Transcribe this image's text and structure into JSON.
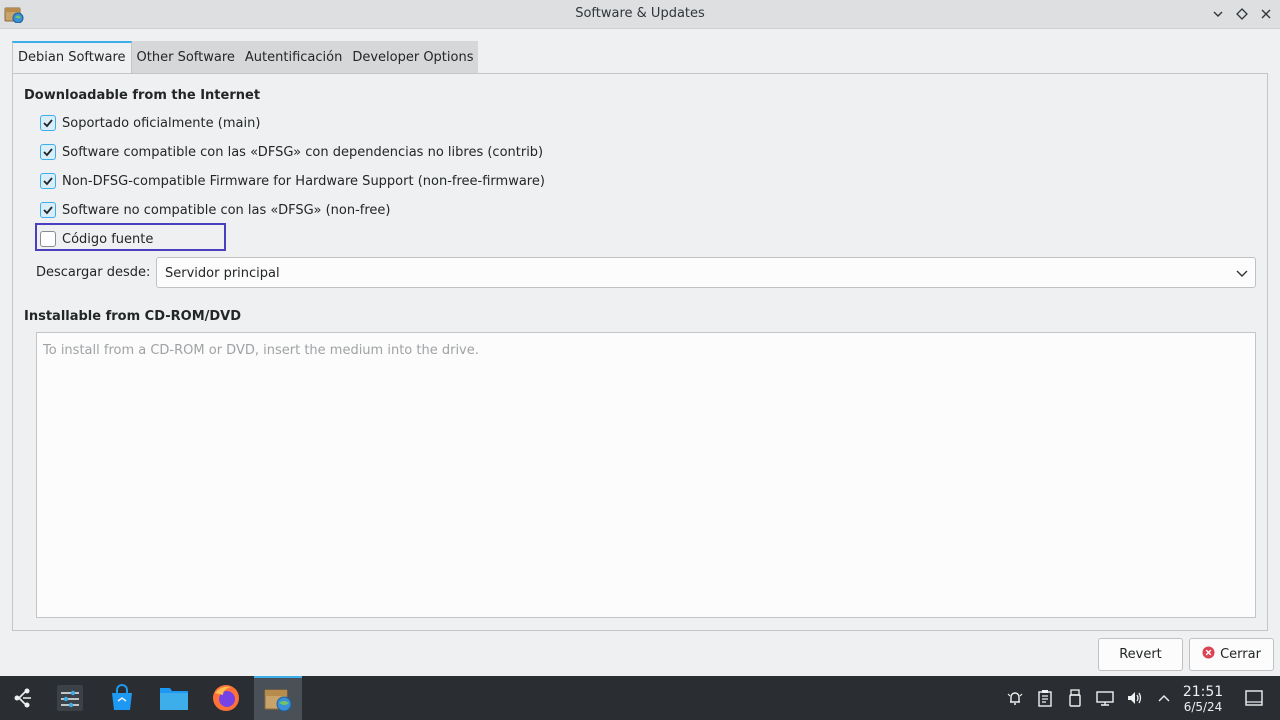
{
  "window": {
    "title": "Software & Updates",
    "controls": [
      "minimize",
      "maximize",
      "close"
    ]
  },
  "tabs": [
    {
      "label": "Debian Software",
      "active": true
    },
    {
      "label": "Other Software",
      "active": false
    },
    {
      "label": "Autentificación",
      "active": false
    },
    {
      "label": "Developer Options",
      "active": false
    }
  ],
  "internet_section": {
    "title": "Downloadable from the Internet",
    "options": [
      {
        "label": "Soportado oficialmente (main)",
        "checked": true
      },
      {
        "label": "Software compatible con las «DFSG» con dependencias no libres (contrib)",
        "checked": true
      },
      {
        "label": "Non-DFSG-compatible Firmware for Hardware Support (non-free-firmware)",
        "checked": true
      },
      {
        "label": "Software no compatible con las «DFSG» (non-free)",
        "checked": true
      },
      {
        "label": "Código fuente",
        "checked": false
      }
    ],
    "download_from_label": "Descargar desde:",
    "download_from_value": "Servidor principal"
  },
  "cdrom_section": {
    "title": "Installable from CD-ROM/DVD",
    "placeholder": "To install from a CD-ROM or DVD, insert the medium into the drive."
  },
  "buttons": {
    "revert": "Revert",
    "close": "Cerrar"
  },
  "taskbar": {
    "apps": [
      "application-launcher",
      "system-settings",
      "discover",
      "dolphin-file-manager",
      "firefox",
      "software-updates"
    ],
    "clock_time": "21:51",
    "clock_date": "6/5/24"
  },
  "colors": {
    "accent": "#3daee9",
    "focus": "#4a3fbf",
    "taskbar": "#2a2e32",
    "close_red": "#da4453"
  }
}
